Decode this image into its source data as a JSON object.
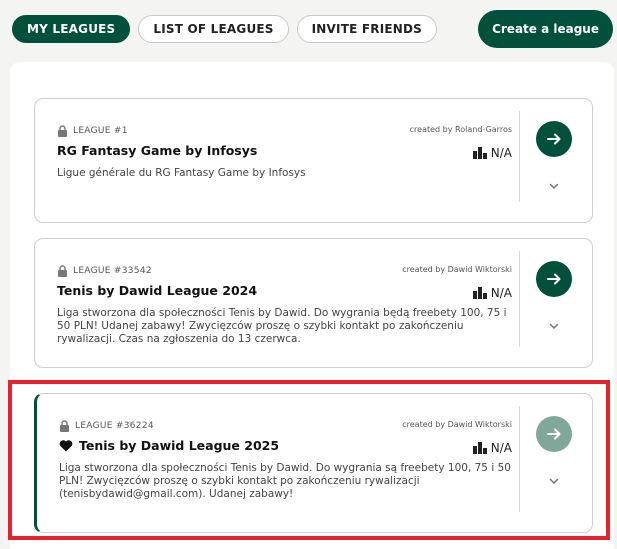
{
  "tabs": {
    "my_leagues": "MY LEAGUES",
    "list_of_leagues": "LIST OF LEAGUES",
    "invite_friends": "INVITE FRIENDS"
  },
  "create_button": "Create a league",
  "colors": {
    "brand": "#00503c",
    "highlight": "#e4232b"
  },
  "leagues": [
    {
      "id_label": "LEAGUE #1",
      "created_by": "created by Roland-Garros",
      "name": "RG Fantasy Game by Infosys",
      "rank": "N/A",
      "description": "Ligue générale du RG Fantasy Game by Infosys"
    },
    {
      "id_label": "LEAGUE #33542",
      "created_by": "created by Dawid Wiktorski",
      "name": "Tenis by Dawid League 2024",
      "rank": "N/A",
      "description": "Liga stworzona dla społeczności Tenis by Dawid. Do wygrania będą freebety 100, 75 i 50 PLN! Udanej zabawy! Zwycięzców proszę o szybki kontakt po zakończeniu rywalizacji. Czas na zgłoszenia do 13 czerwca."
    },
    {
      "id_label": "LEAGUE #36224",
      "created_by": "created by Dawid Wiktorski",
      "name": "Tenis by Dawid League 2025",
      "rank": "N/A",
      "description": "Liga stworzona dla społeczności Tenis by Dawid. Do wygrania są freebety 100, 75 i 50 PLN! Zwycięzców proszę o szybki kontakt po zakończeniu rywalizacji (tenisbydawid@gmail.com). Udanej zabawy!"
    }
  ]
}
